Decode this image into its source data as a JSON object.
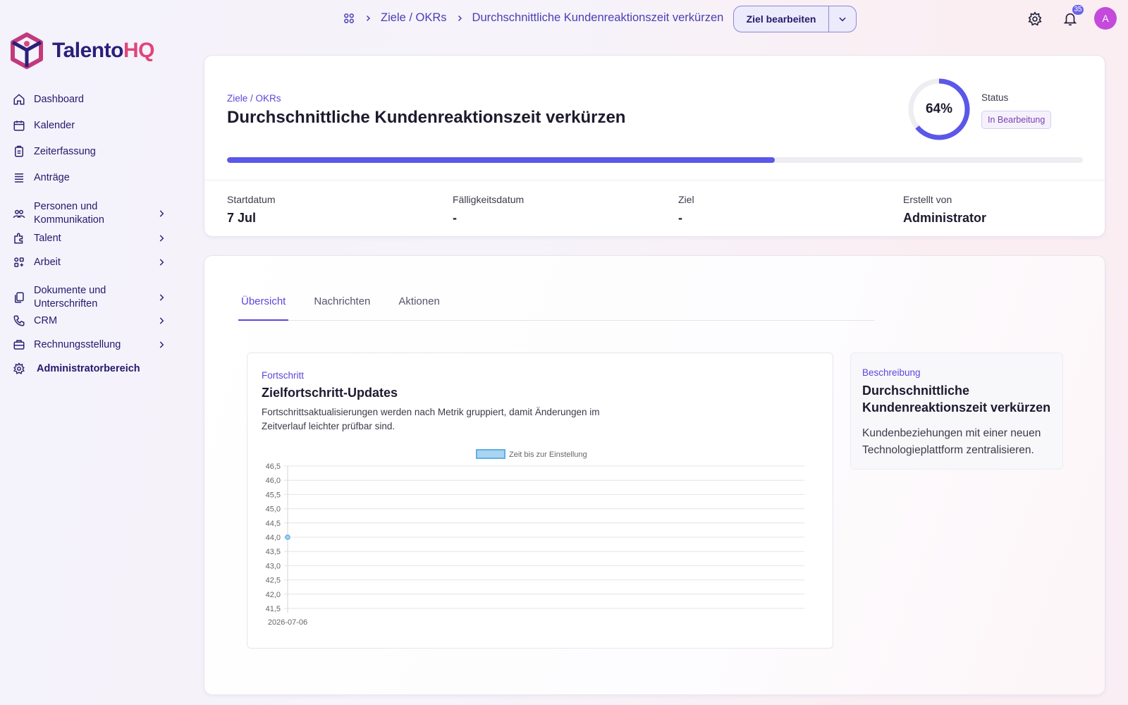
{
  "app": {
    "logo_part1": "Talento",
    "logo_part2": "HQ",
    "colors": {
      "primary": "#5b47d9",
      "brand_dark": "#2a1f7a",
      "brand_pink": "#e0457a",
      "avatar": "#c44adc"
    }
  },
  "sidebar": {
    "items": [
      {
        "label": "Dashboard",
        "icon": "home-icon",
        "has_children": false
      },
      {
        "label": "Kalender",
        "icon": "calendar-icon",
        "has_children": false
      },
      {
        "label": "Zeiterfassung",
        "icon": "clipboard-icon",
        "has_children": false
      },
      {
        "label": "Anträge",
        "icon": "list-icon",
        "has_children": false
      },
      {
        "label": "Personen und Kommunikation",
        "icon": "people-icon",
        "has_children": true
      },
      {
        "label": "Talent",
        "icon": "puzzle-icon",
        "has_children": true
      },
      {
        "label": "Arbeit",
        "icon": "apps-icon",
        "has_children": true
      },
      {
        "label": "Dokumente und Unterschriften",
        "icon": "documents-icon",
        "has_children": true
      },
      {
        "label": "CRM",
        "icon": "phone-icon",
        "has_children": true
      },
      {
        "label": "Rechnungsstellung",
        "icon": "briefcase-icon",
        "has_children": true
      },
      {
        "label": "Administratorbereich",
        "icon": "gear-icon",
        "has_children": false
      }
    ]
  },
  "topbar": {
    "breadcrumb": [
      "Ziele / OKRs",
      "Durchschnittliche Kundenreaktionszeit verkürzen"
    ],
    "edit_button": "Ziel bearbeiten",
    "notification_count": "35",
    "avatar_initial": "A"
  },
  "goal": {
    "eyebrow": "Ziele / OKRs",
    "title": "Durchschnittliche Kundenreaktionszeit verkürzen",
    "progress_percent": 64,
    "progress_label": "64%",
    "status_label": "Status",
    "status_value": "In Bearbeitung",
    "meta": [
      {
        "label": "Startdatum",
        "value": "7 Jul"
      },
      {
        "label": "Fälligkeitsdatum",
        "value": "-"
      },
      {
        "label": "Ziel",
        "value": "-"
      },
      {
        "label": "Erstellt von",
        "value": "Administrator"
      }
    ]
  },
  "tabs": [
    {
      "label": "Übersicht",
      "active": true
    },
    {
      "label": "Nachrichten",
      "active": false
    },
    {
      "label": "Aktionen",
      "active": false
    }
  ],
  "progress_card": {
    "eyebrow": "Fortschritt",
    "title": "Zielfortschritt-Updates",
    "description": "Fortschrittsaktualisierungen werden nach Metrik gruppiert, damit Änderungen im Zeitverlauf leichter prüfbar sind."
  },
  "chart_data": {
    "type": "line",
    "x": [
      "2026-07-06"
    ],
    "series": [
      {
        "name": "Zeit bis zur Einstellung",
        "values": [
          44.0
        ],
        "color": "#5fb0e3"
      }
    ],
    "ylim": [
      41.5,
      46.5
    ],
    "y_ticks": [
      "46,5",
      "46,0",
      "45,5",
      "45,0",
      "44,5",
      "44,0",
      "43,5",
      "43,0",
      "42,5",
      "42,0",
      "41,5"
    ],
    "legend": "top",
    "grid": true
  },
  "description_card": {
    "eyebrow": "Beschreibung",
    "title": "Durchschnittliche Kundenreaktionszeit verkürzen",
    "text": "Kundenbeziehungen mit einer neuen Technologieplattform zentralisieren."
  }
}
